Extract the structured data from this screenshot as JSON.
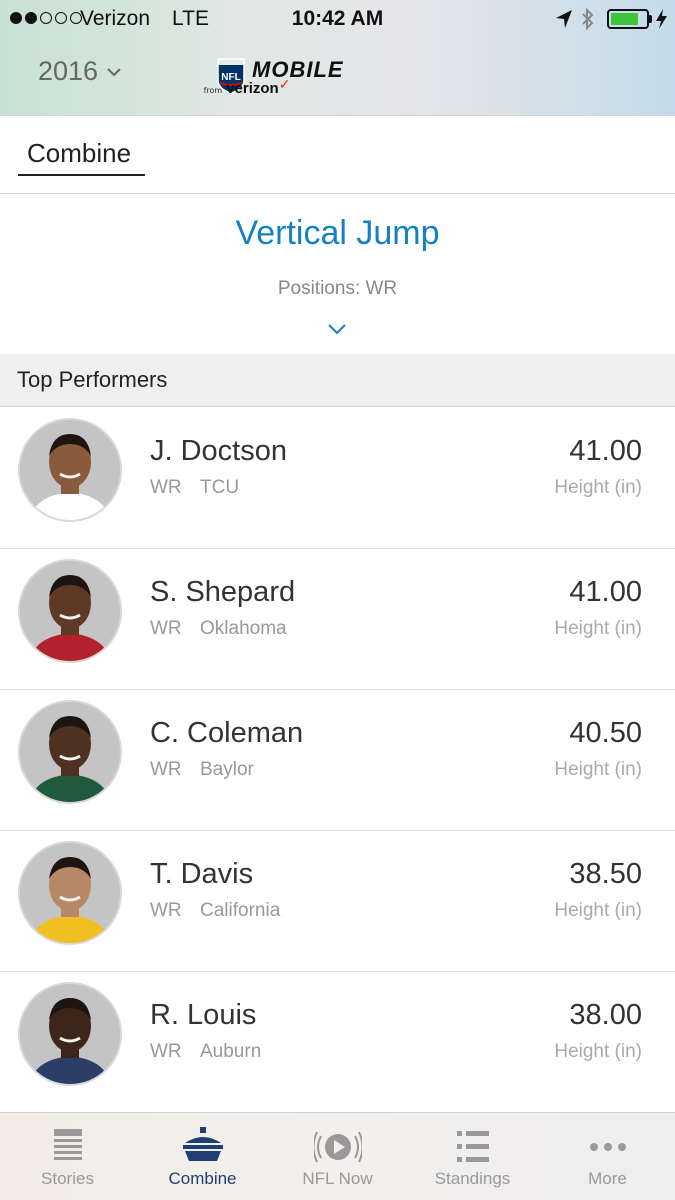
{
  "status_bar": {
    "carrier": "Verizon",
    "network": "LTE",
    "time": "10:42 AM",
    "battery_level": 0.8
  },
  "nav": {
    "year": "2016",
    "brand_mobile": "MOBILE",
    "brand_from": "from",
    "brand_sponsor": "verizon",
    "brand_check": "✓"
  },
  "tabs": {
    "active_label": "Combine"
  },
  "drill": {
    "title": "Vertical Jump",
    "positions": "Positions: WR"
  },
  "section": {
    "title": "Top Performers"
  },
  "performers": [
    {
      "name": "J. Doctson",
      "position": "WR",
      "school": "TCU",
      "value": "41.00",
      "unit": "Height (in)",
      "skin": "#8a5a3c",
      "jersey": "#ffffff"
    },
    {
      "name": "S. Shepard",
      "position": "WR",
      "school": "Oklahoma",
      "value": "41.00",
      "unit": "Height (in)",
      "skin": "#5e3a26",
      "jersey": "#b3202e"
    },
    {
      "name": "C. Coleman",
      "position": "WR",
      "school": "Baylor",
      "value": "40.50",
      "unit": "Height (in)",
      "skin": "#4f3122",
      "jersey": "#1f5a3a"
    },
    {
      "name": "T. Davis",
      "position": "WR",
      "school": "California",
      "value": "38.50",
      "unit": "Height (in)",
      "skin": "#b88866",
      "jersey": "#f0c020"
    },
    {
      "name": "R. Louis",
      "position": "WR",
      "school": "Auburn",
      "value": "38.00",
      "unit": "Height (in)",
      "skin": "#3e2519",
      "jersey": "#2b3f66"
    }
  ],
  "tabbar": {
    "items": [
      {
        "label": "Stories",
        "icon": "stories-icon",
        "active": false
      },
      {
        "label": "Combine",
        "icon": "combine-icon",
        "active": true
      },
      {
        "label": "NFL Now",
        "icon": "nfl-now-icon",
        "active": false
      },
      {
        "label": "Standings",
        "icon": "standings-icon",
        "active": false
      },
      {
        "label": "More",
        "icon": "more-icon",
        "active": false
      }
    ]
  },
  "colors": {
    "accent": "#1581c0",
    "active_tab": "#1f3f74",
    "battery": "#3cc53c",
    "verizon_check": "#d52b1e"
  }
}
